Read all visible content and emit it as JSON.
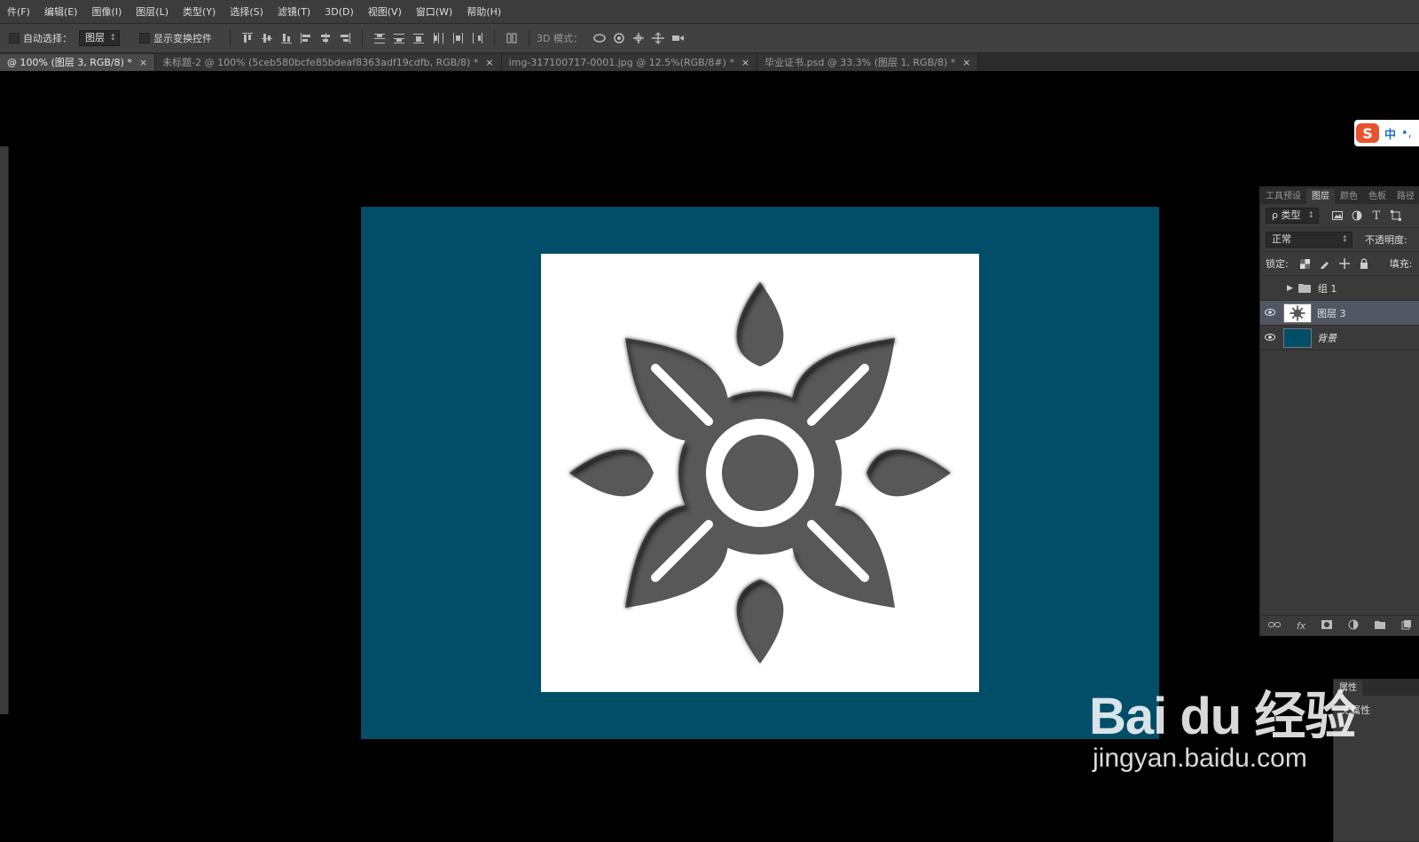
{
  "menu": [
    "件(F)",
    "编辑(E)",
    "图像(I)",
    "图层(L)",
    "类型(Y)",
    "选择(S)",
    "滤镜(T)",
    "3D(D)",
    "视图(V)",
    "窗口(W)",
    "帮助(H)"
  ],
  "options": {
    "auto_select_label": "自动选择：",
    "auto_select_value": "图层",
    "show_transform_label": "显示变换控件",
    "mode_3d_label": "3D 模式："
  },
  "tabs": [
    {
      "label": "@ 100% (图层 3, RGB/8) *",
      "active": true
    },
    {
      "label": "未标题-2 @ 100% (5ceb580bcfe85bdeaf8363adf19cdfb, RGB/8) *",
      "active": false
    },
    {
      "label": "img-317100717-0001.jpg @ 12.5%(RGB/8#) *",
      "active": false
    },
    {
      "label": "毕业证书.psd @ 33.3% (图层 1, RGB/8) *",
      "active": false
    }
  ],
  "tab_close": "×",
  "ime": {
    "logo": "S",
    "lang": "中",
    "punct": "•,"
  },
  "layers_panel": {
    "tabs": [
      "工具预设",
      "图层",
      "颜色",
      "色板",
      "路径"
    ],
    "active_tab": "图层",
    "filter_value": "ρ 类型",
    "blend_mode": "正常",
    "opacity_label": "不透明度:",
    "lock_label": "锁定:",
    "fill_label": "填充:",
    "layers": [
      {
        "name": "组 1",
        "type": "group",
        "visible": false,
        "selected": false
      },
      {
        "name": "图层 3",
        "type": "layer",
        "visible": true,
        "selected": true
      },
      {
        "name": "背景",
        "type": "background",
        "visible": true,
        "selected": false
      }
    ],
    "bottom_fx": "fx"
  },
  "properties_panel": {
    "title": "属性",
    "content": "无属性"
  },
  "canvas": {
    "bg_color": "#024e69",
    "inner_color": "#ffffff",
    "flower_color": "#595959"
  },
  "watermark": {
    "main": "Bai du 经验",
    "url": "jingyan.baidu.com"
  }
}
